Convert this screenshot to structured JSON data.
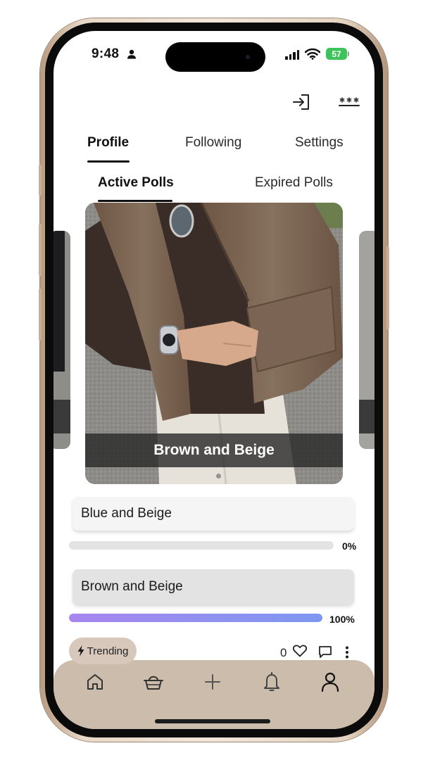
{
  "status_bar": {
    "time": "9:48",
    "battery": "57",
    "person_icon": "person-fill-icon",
    "signal_icon": "cellular-signal-icon",
    "wifi_icon": "wifi-icon"
  },
  "header": {
    "login_icon": "sign-in-icon",
    "menu_icon": "password-dots-icon"
  },
  "tabs": [
    {
      "label": "Profile",
      "active": true
    },
    {
      "label": "Following",
      "active": false
    },
    {
      "label": "Settings",
      "active": false
    }
  ],
  "poll_tabs": [
    {
      "label": "Active Polls",
      "active": true
    },
    {
      "label": "Expired Polls",
      "active": false
    }
  ],
  "poll": {
    "image_caption": "Brown and Beige",
    "options": [
      {
        "label": "Blue and Beige",
        "percent": "0%",
        "fill_fraction": 0.0
      },
      {
        "label": "Brown and Beige",
        "percent": "100%",
        "fill_fraction": 1.0
      }
    ]
  },
  "footer_row": {
    "trending_label": "Trending",
    "trending_icon": "lightning-icon",
    "like_count": "0",
    "like_icon": "heart-icon",
    "comment_icon": "comment-icon",
    "more_icon": "more-vertical-icon"
  },
  "bottom_nav": [
    {
      "name": "home",
      "icon": "home-icon"
    },
    {
      "name": "shop",
      "icon": "basket-icon"
    },
    {
      "name": "create",
      "icon": "plus-icon"
    },
    {
      "name": "notifications",
      "icon": "bell-icon"
    },
    {
      "name": "profile",
      "icon": "user-icon"
    }
  ],
  "colors": {
    "nav_background": "#cbbcab",
    "trending_background": "#d8c8bb",
    "progress_gradient_start": "#a786f0",
    "progress_gradient_end": "#7e97f1",
    "battery_green": "#3cc45a"
  }
}
